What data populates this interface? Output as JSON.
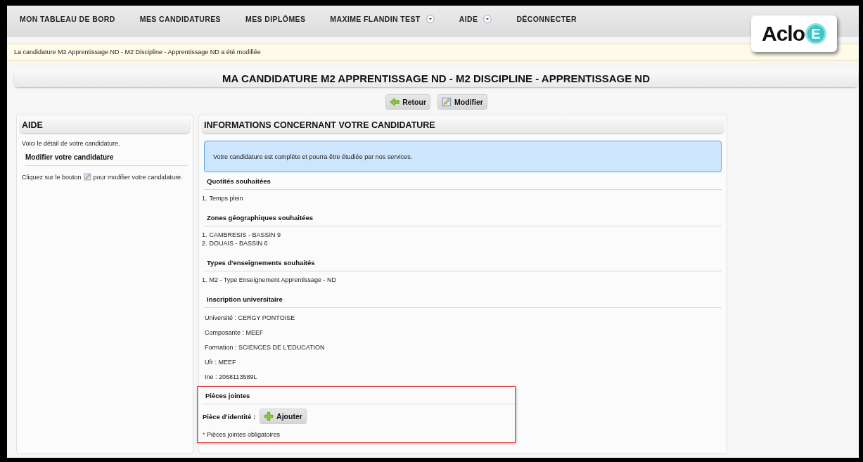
{
  "nav": [
    {
      "label": "MON TABLEAU DE BORD",
      "dropdown": false
    },
    {
      "label": "MES CANDIDATURES",
      "dropdown": false
    },
    {
      "label": "MES DIPLÔMES",
      "dropdown": false
    },
    {
      "label": "MAXIME FLANDIN TEST",
      "dropdown": true
    },
    {
      "label": "AIDE",
      "dropdown": true
    },
    {
      "label": "DÉCONNECTER",
      "dropdown": false
    }
  ],
  "logo": {
    "text": "Aclo",
    "badge": "E"
  },
  "notice": "La candidature M2 Apprentissage ND - M2 Discipline - Apprentissage ND a été modifiée",
  "page_title": "MA CANDIDATURE M2 APPRENTISSAGE ND - M2 DISCIPLINE - APPRENTISSAGE ND",
  "actions": [
    {
      "label": "Retour",
      "kind": "back"
    },
    {
      "label": "Modifier",
      "kind": "edit"
    }
  ],
  "help": {
    "title": "AIDE",
    "intro": "Voici le détail de votre candidature.",
    "subtitle": "Modifier votre candidature",
    "instruction_before": "Cliquez sur le bouton",
    "instruction_after": "pour modifier votre candidature."
  },
  "info": {
    "title": "INFORMATIONS CONCERNANT VOTRE CANDIDATURE",
    "status_message": "Votre candidature est complète et pourra être étudiée par nos services.",
    "sections": [
      {
        "title": "Quotités souhaitées",
        "kind": "ordered",
        "highlighted": false,
        "items": [
          {
            "number": "1.",
            "text": "Temps plein"
          }
        ]
      },
      {
        "title": "Zones géographiques souhaitées",
        "kind": "ordered",
        "highlighted": false,
        "items": [
          {
            "number": "1.",
            "text": "CAMBRESIS - BASSIN 9"
          },
          {
            "number": "2.",
            "text": "DOUAIS - BASSIN 6"
          }
        ]
      },
      {
        "title": "Types d'enseignements souhaités",
        "kind": "ordered",
        "highlighted": false,
        "items": [
          {
            "number": "1.",
            "text": "M2 - Type Enseignement Apprentissage - ND"
          }
        ]
      },
      {
        "title": "Inscription universitaire",
        "kind": "fields",
        "highlighted": false,
        "items": [
          "Université : CERGY PONTOISE",
          "Composante : MEEF",
          "Formation : SCIENCES DE L'EDUCATION",
          "Ufr : MEEF",
          "Ine : 2068113589L"
        ]
      },
      {
        "title": "Pièces jointes",
        "kind": "attachments",
        "highlighted": true,
        "label": "Pièce d'identité :",
        "button": "Ajouter",
        "note_mark": "*",
        "note": "Pièces jointes obligatoires"
      }
    ]
  }
}
